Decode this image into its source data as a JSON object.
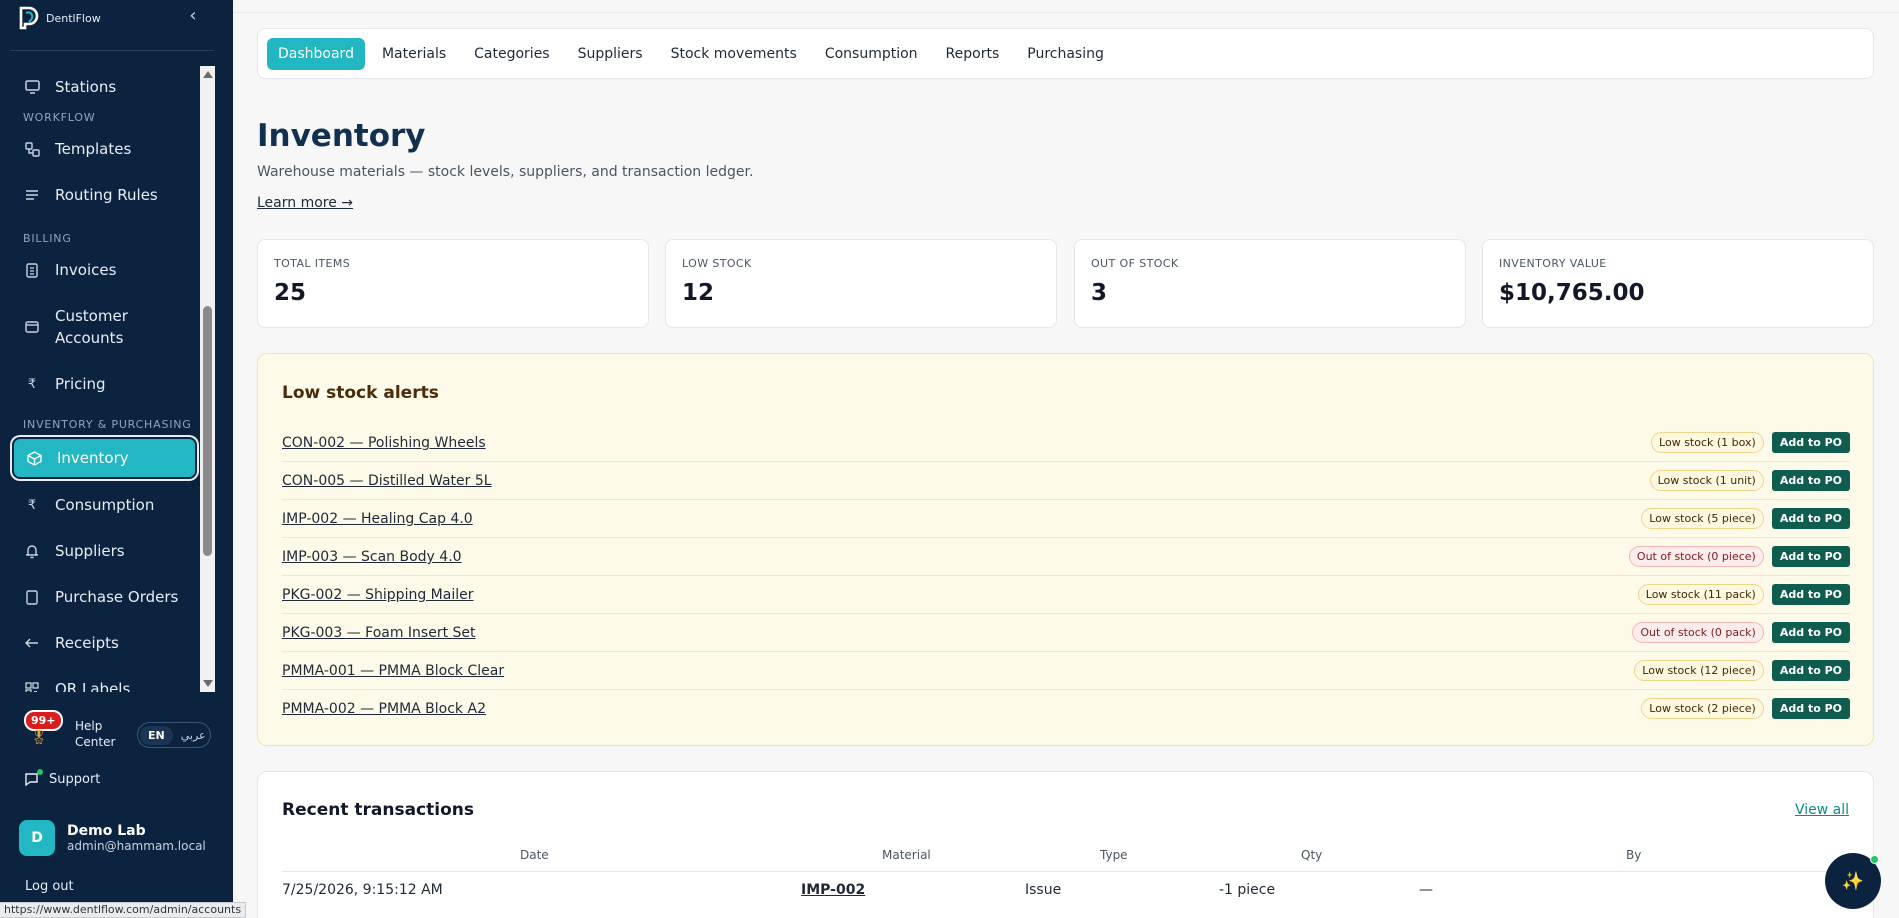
{
  "brand": {
    "name": "DentlFlow",
    "logo_icon": "tooth-logo-icon",
    "collapse_icon": "chevron-left-icon"
  },
  "sidebar": {
    "items": [
      {
        "label": "Stations",
        "icon": "monitor-icon"
      },
      {
        "section": "WORKFLOW"
      },
      {
        "label": "Templates",
        "icon": "templates-icon"
      },
      {
        "label": "Routing Rules",
        "icon": "list-icon"
      },
      {
        "section": "BILLING"
      },
      {
        "label": "Invoices",
        "icon": "invoice-icon"
      },
      {
        "label": "Customer Accounts",
        "icon": "card-icon"
      },
      {
        "label": "Pricing",
        "icon": "rupee-icon"
      },
      {
        "section": "INVENTORY & PURCHASING"
      },
      {
        "label": "Inventory",
        "icon": "box-icon",
        "active": true
      },
      {
        "label": "Consumption",
        "icon": "rupee-icon"
      },
      {
        "label": "Suppliers",
        "icon": "bell-icon"
      },
      {
        "label": "Purchase Orders",
        "icon": "document-icon"
      },
      {
        "label": "Receipts",
        "icon": "arrow-left-icon"
      },
      {
        "label": "QR Labels",
        "icon": "qr-icon"
      }
    ],
    "help": {
      "badge": "99+",
      "label_line1": "Help",
      "label_line2": "Center"
    },
    "lang": {
      "en": "EN",
      "ar": "عربي"
    },
    "support": "Support",
    "user": {
      "initial": "D",
      "name": "Demo Lab",
      "email": "admin@hammam.local"
    },
    "logout": "Log out",
    "status_url": "https://www.dentlflow.com/admin/accounts"
  },
  "tabs": [
    "Dashboard",
    "Materials",
    "Categories",
    "Suppliers",
    "Stock movements",
    "Consumption",
    "Reports",
    "Purchasing"
  ],
  "active_tab": "Dashboard",
  "header": {
    "title": "Inventory",
    "subtitle": "Warehouse materials — stock levels, suppliers, and transaction ledger.",
    "learn_more": "Learn more →"
  },
  "stats": [
    {
      "label": "TOTAL ITEMS",
      "value": "25"
    },
    {
      "label": "LOW STOCK",
      "value": "12"
    },
    {
      "label": "OUT OF STOCK",
      "value": "3"
    },
    {
      "label": "INVENTORY VALUE",
      "value": "$10,765.00"
    }
  ],
  "alerts": {
    "title": "Low stock alerts",
    "button_label": "Add to PO",
    "rows": [
      {
        "item": "CON-002 — Polishing Wheels",
        "status": "Low stock (1 box)",
        "kind": "low"
      },
      {
        "item": "CON-005 — Distilled Water 5L",
        "status": "Low stock (1 unit)",
        "kind": "low"
      },
      {
        "item": "IMP-002 — Healing Cap 4.0",
        "status": "Low stock (5 piece)",
        "kind": "low"
      },
      {
        "item": "IMP-003 — Scan Body 4.0",
        "status": "Out of stock (0 piece)",
        "kind": "out"
      },
      {
        "item": "PKG-002 — Shipping Mailer",
        "status": "Low stock (11 pack)",
        "kind": "low"
      },
      {
        "item": "PKG-003 — Foam Insert Set",
        "status": "Out of stock (0 pack)",
        "kind": "out"
      },
      {
        "item": "PMMA-001 — PMMA Block Clear",
        "status": "Low stock (12 piece)",
        "kind": "low"
      },
      {
        "item": "PMMA-002 — PMMA Block A2",
        "status": "Low stock (2 piece)",
        "kind": "low"
      }
    ]
  },
  "recent": {
    "title": "Recent transactions",
    "view_all": "View all",
    "columns": [
      "Date",
      "Material",
      "Type",
      "Qty",
      "By"
    ],
    "rows": [
      {
        "date": "7/25/2026, 9:15:12 AM",
        "material": "IMP-002",
        "type": "Issue",
        "qty": "-1 piece",
        "by": "—"
      }
    ]
  },
  "fab": {
    "icon": "sparkle-icon",
    "glyph": "✨"
  },
  "colors": {
    "accent": "#22b7c3",
    "sidebar": "#0c2340",
    "po_button": "#0f5d4f"
  }
}
